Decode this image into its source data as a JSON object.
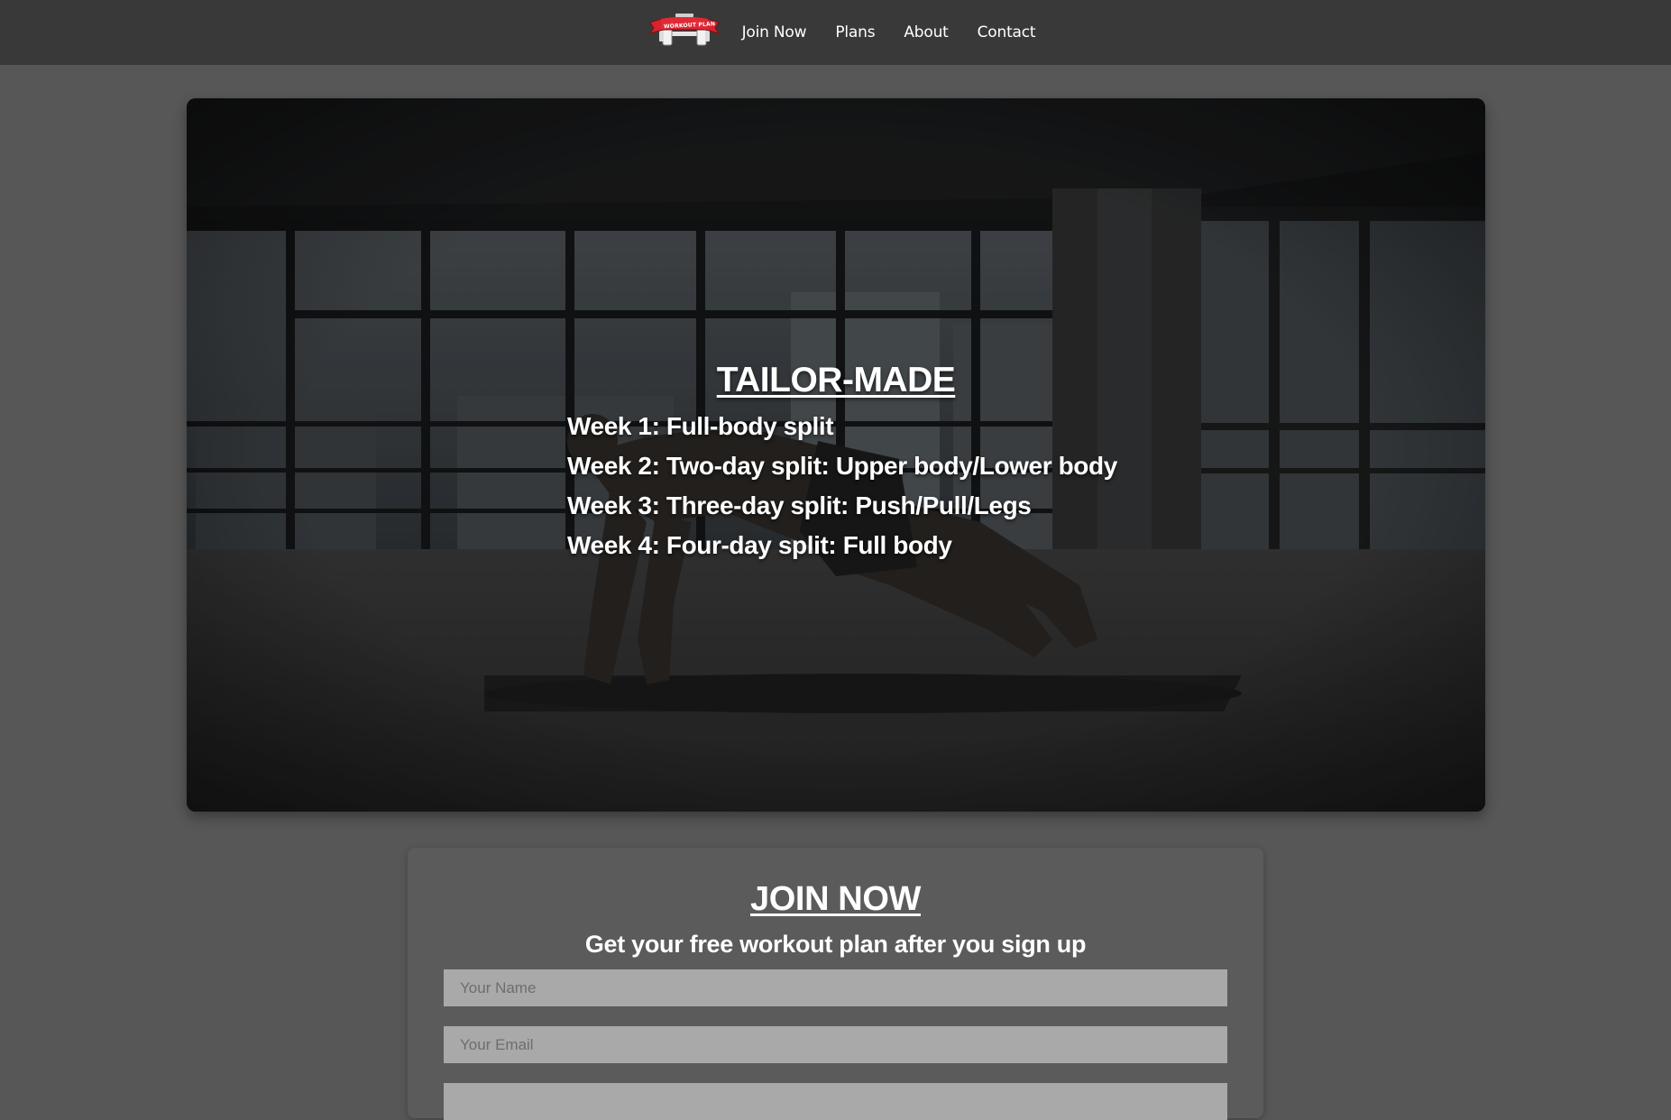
{
  "nav": {
    "logo_text": "WORKOUT PLAN",
    "links": [
      "Join Now",
      "Plans",
      "About",
      "Contact"
    ]
  },
  "hero": {
    "title": "TAILOR-MADE",
    "weeks": [
      "Week 1: Full-body split",
      "Week 2: Two-day split: Upper body/Lower body",
      "Week 3: Three-day split: Push/Pull/Legs",
      "Week 4: Four-day split: Full body"
    ]
  },
  "join": {
    "title": "JOIN NOW",
    "subtitle": "Get your free workout plan after you sign up",
    "name_placeholder": "Your Name",
    "email_placeholder": "Your Email"
  },
  "colors": {
    "page_bg": "#575757",
    "nav_bg": "#393939",
    "logo_red": "#d8232f",
    "input_bg": "#a9a9a9"
  }
}
